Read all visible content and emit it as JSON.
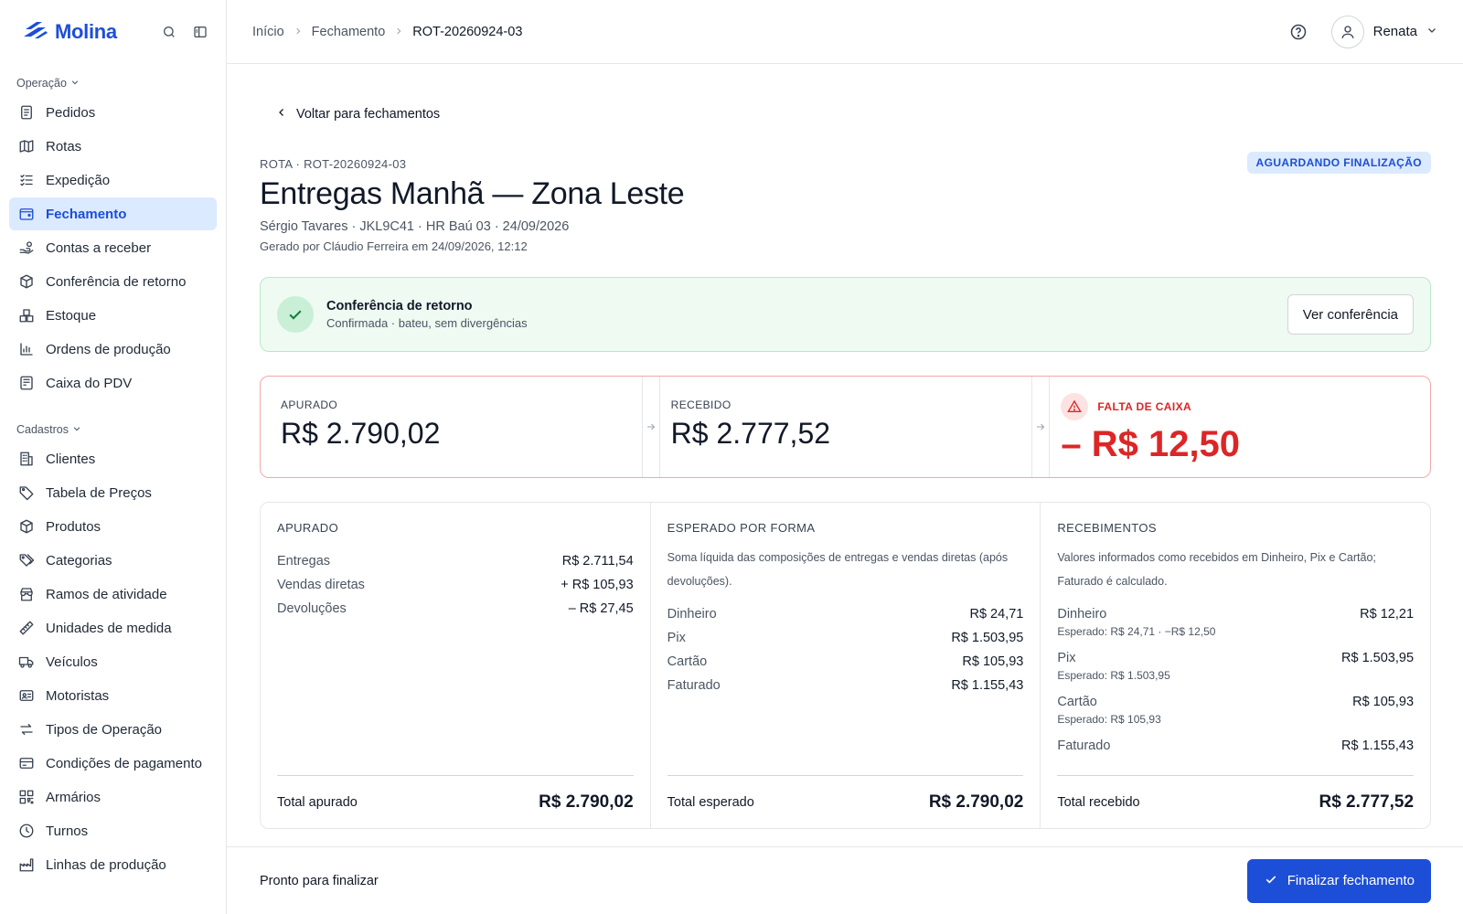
{
  "brand": {
    "name": "Molina"
  },
  "sidebar": {
    "sections": [
      {
        "label": "Operação",
        "items": [
          {
            "label": "Pedidos",
            "icon": "orders-icon"
          },
          {
            "label": "Rotas",
            "icon": "map-icon"
          },
          {
            "label": "Expedição",
            "icon": "checklist-icon"
          },
          {
            "label": "Fechamento",
            "icon": "wallet-icon",
            "active": true
          },
          {
            "label": "Contas a receber",
            "icon": "hand-coins-icon"
          },
          {
            "label": "Conferência de retorno",
            "icon": "package-check-icon"
          },
          {
            "label": "Estoque",
            "icon": "boxes-icon"
          },
          {
            "label": "Ordens de produção",
            "icon": "chart-icon"
          },
          {
            "label": "Caixa do PDV",
            "icon": "register-icon"
          }
        ]
      },
      {
        "label": "Cadastros",
        "items": [
          {
            "label": "Clientes",
            "icon": "building-icon"
          },
          {
            "label": "Tabela de Preços",
            "icon": "tag-icon"
          },
          {
            "label": "Produtos",
            "icon": "box-icon"
          },
          {
            "label": "Categorias",
            "icon": "tags-icon"
          },
          {
            "label": "Ramos de atividade",
            "icon": "store-icon"
          },
          {
            "label": "Unidades de medida",
            "icon": "ruler-icon"
          },
          {
            "label": "Veículos",
            "icon": "truck-icon"
          },
          {
            "label": "Motoristas",
            "icon": "id-card-icon"
          },
          {
            "label": "Tipos de Operação",
            "icon": "arrows-icon"
          },
          {
            "label": "Condições de pagamento",
            "icon": "credit-card-icon"
          },
          {
            "label": "Armários",
            "icon": "qr-icon"
          },
          {
            "label": "Turnos",
            "icon": "clock-icon"
          },
          {
            "label": "Linhas de produção",
            "icon": "factory-icon"
          }
        ]
      }
    ]
  },
  "breadcrumb": [
    "Início",
    "Fechamento",
    "ROT-20260924-03"
  ],
  "user": {
    "name": "Renata"
  },
  "page": {
    "back_label": "Voltar para fechamentos",
    "route_code": "ROTA · ROT-20260924-03",
    "status": "AGUARDANDO FINALIZAÇÃO",
    "title": "Entregas Manhã — Zona Leste",
    "meta": "Sérgio Tavares · JKL9C41 · HR Baú 03 · 24/09/2026",
    "generated": "Gerado por Cláudio Ferreira em 24/09/2026, 12:12"
  },
  "conferencia": {
    "title": "Conferência de retorno",
    "subtitle": "Confirmada · bateu, sem divergências",
    "button": "Ver conferência"
  },
  "summary": {
    "apurado": {
      "label": "APURADO",
      "value": "R$ 2.790,02"
    },
    "recebido": {
      "label": "RECEBIDO",
      "value": "R$ 2.777,52"
    },
    "falta": {
      "label": "FALTA DE CAIXA",
      "value": "– R$ 12,50"
    }
  },
  "details": {
    "apurado": {
      "title": "APURADO",
      "rows": [
        {
          "label": "Entregas",
          "value": "R$ 2.711,54"
        },
        {
          "label": "Vendas diretas",
          "value": "+ R$ 105,93"
        },
        {
          "label": "Devoluções",
          "value": "– R$ 27,45"
        }
      ],
      "total_label": "Total apurado",
      "total": "R$ 2.790,02"
    },
    "esperado": {
      "title": "ESPERADO POR FORMA",
      "desc": "Soma líquida das composições de entregas e vendas diretas (após devoluções).",
      "rows": [
        {
          "label": "Dinheiro",
          "value": "R$ 24,71"
        },
        {
          "label": "Pix",
          "value": "R$ 1.503,95"
        },
        {
          "label": "Cartão",
          "value": "R$ 105,93"
        },
        {
          "label": "Faturado",
          "value": "R$ 1.155,43"
        }
      ],
      "total_label": "Total esperado",
      "total": "R$ 2.790,02"
    },
    "recebimentos": {
      "title": "RECEBIMENTOS",
      "desc": "Valores informados como recebidos em Dinheiro, Pix e Cartão; Faturado é calculado.",
      "rows": [
        {
          "label": "Dinheiro",
          "value": "R$ 12,21",
          "hint": "Esperado: R$ 24,71 · −R$ 12,50"
        },
        {
          "label": "Pix",
          "value": "R$ 1.503,95",
          "hint": "Esperado: R$ 1.503,95"
        },
        {
          "label": "Cartão",
          "value": "R$ 105,93",
          "hint": "Esperado: R$ 105,93"
        },
        {
          "label": "Faturado",
          "value": "R$ 1.155,43",
          "hint": ""
        }
      ],
      "total_label": "Total recebido",
      "total": "R$ 2.777,52"
    }
  },
  "footer": {
    "status_text": "Pronto para finalizar",
    "button": "Finalizar fechamento"
  },
  "colors": {
    "accent": "#1d4ed8",
    "danger": "#dc2626",
    "success": "#16a34a"
  }
}
